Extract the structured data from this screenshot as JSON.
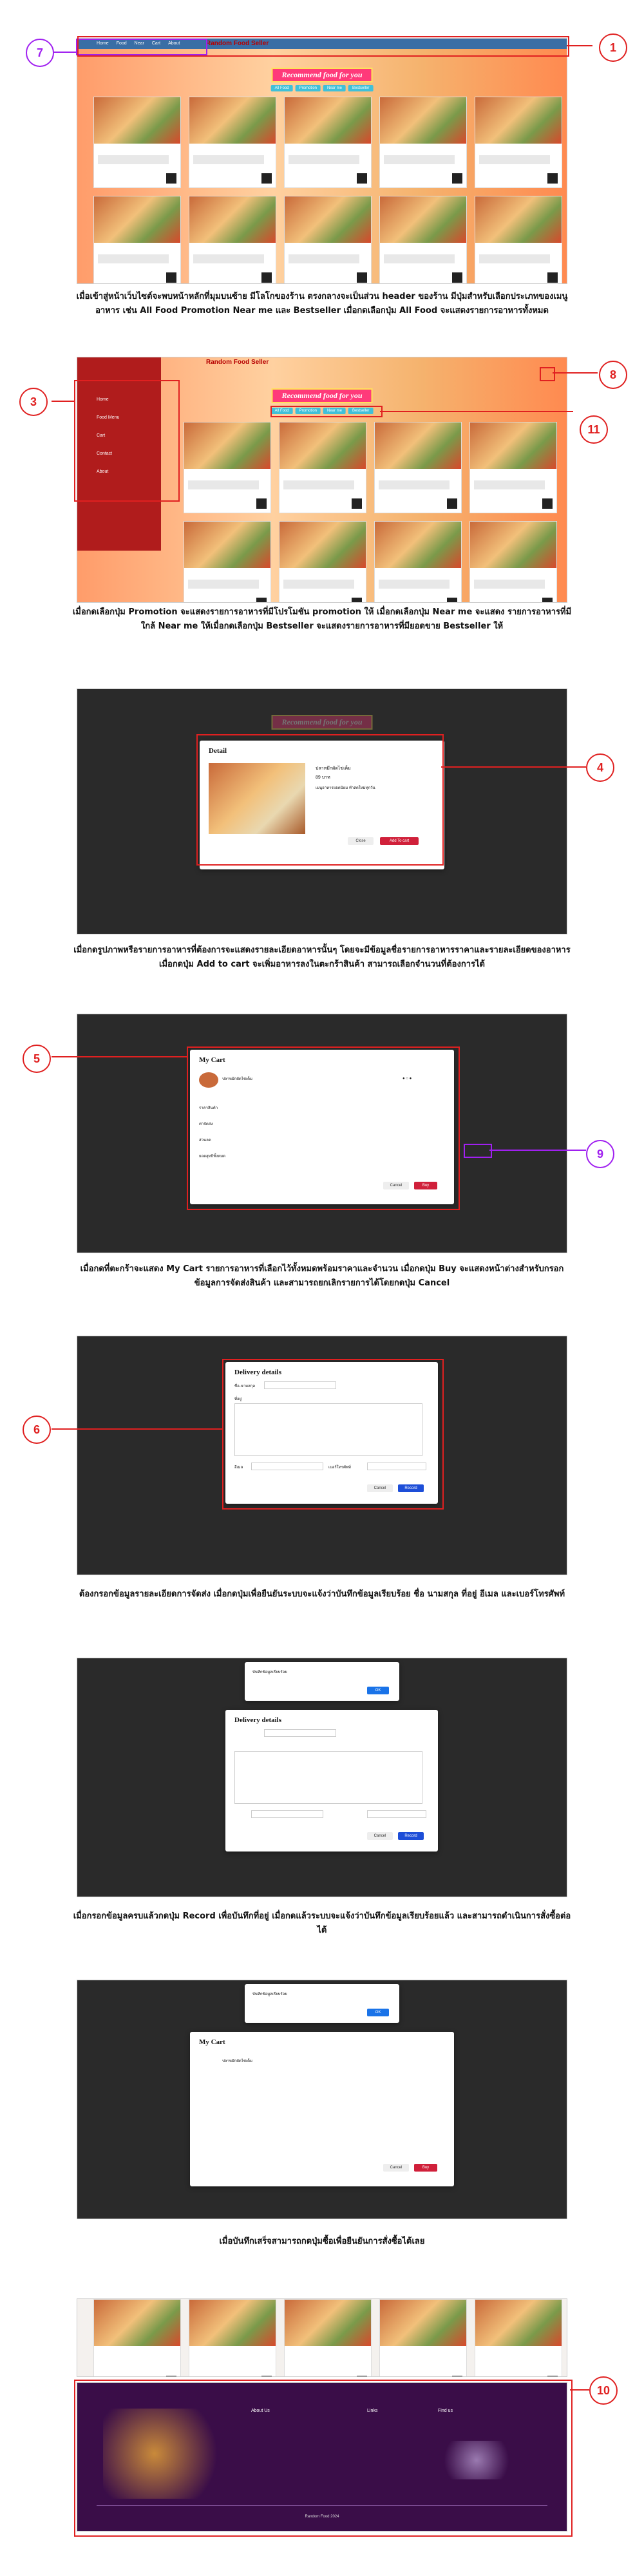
{
  "brand": "Random Food Seller",
  "recommend_banner": "Recommend food for you",
  "nav_links": [
    "Home",
    "Food",
    "Near",
    "Cart",
    "About"
  ],
  "pills": [
    "All Food",
    "Promotion",
    "Near me",
    "Bestseller"
  ],
  "callouts": {
    "c1": "1",
    "c3": "3",
    "c4": "4",
    "c5": "5",
    "c6": "6",
    "c7": "7",
    "c8": "8",
    "c9": "9",
    "c10": "10",
    "c11": "11"
  },
  "captions": {
    "cap1": "เมื่อเข้าสู่หน้าเว็บไซต์จะพบหน้าหลักที่มุมบนซ้าย มีโลโกของร้าน ตรงกลางจะเป็นส่วน header ของร้าน มีปุ่มสำหรับเลือกประเภทของเมนู อาหาร เช่น All Food Promotion Near me และ Bestseller เมื่อกดเลือกปุ่ม All Food จะแสดงรายการอาหารทั้งหมด",
    "cap2": "เมื่อกดเลือกปุ่ม Promotion จะแสดงรายการอาหารที่มีโปรโมชัน promotion ให้ เมื่อกดเลือกปุ่ม Near me จะแสดง รายการอาหารที่มีใกล้ Near me ให้เมื่อกดเลือกปุ่ม Bestseller จะแสดงรายการอาหารที่มียอดขาย Bestseller ให้",
    "cap3": "เมื่อกดรูปภาพหรือรายการอาหารที่ต้องการจะแสดงรายละเอียดอาหารนั้นๆ โดยจะมีข้อมูลชื่อรายการอาหารราคาและรายละเอียดของอาหาร เมื่อกดปุ่ม Add to cart จะเพิ่มอาหารลงในตะกร้าสินค้า สามารถเลือกจำนวนที่ต้องการได้",
    "cap4": "เมื่อกดที่ตะกร้าจะแสดง My Cart รายการอาหารที่เลือกไว้ทั้งหมดพร้อมราคาและจำนวน เมื่อกดปุ่ม Buy จะแสดงหน้าต่างสำหรับกรอกข้อมูลการจัดส่งสินค้า และสามารถยกเลิกรายการได้โดยกดปุ่ม Cancel",
    "cap5": "ต้องกรอกข้อมูลรายละเอียดการจัดส่ง เมื่อกดปุ่มเพื่อยืนยันระบบจะแจ้งว่าบันทึกข้อมูลเรียบร้อย ชื่อ นามสกุล ที่อยู่ อีเมล และเบอร์โทรศัพท์",
    "cap6": "เมื่อกรอกข้อมูลครบแล้วกดปุ่ม Record เพื่อบันทึกที่อยู่ เมื่อกดแล้วระบบจะแจ้งว่าบันทึกข้อมูลเรียบร้อยแล้ว และสามารถดำเนินการสั่งซื้อต่อได้",
    "cap7": "เมื่อบันทึกเสร็จสามารถกดปุ่มซื้อเพื่อยืนยันการสั่งซื้อได้เลย"
  },
  "detail_modal": {
    "title": "Detail",
    "name": "ปลาหมึกผัดไข่เค็ม",
    "price": "89 บาท",
    "desc": "เมนูอาหารยอดนิยม ทำสดใหม่ทุกวัน",
    "close": "Close",
    "add": "Add To cart"
  },
  "cart_modal": {
    "title": "My Cart",
    "item": "ปลาหมึกผัดไข่เค็ม",
    "rows": [
      "ราคาสินค้า",
      "ค่าจัดส่ง",
      "ส่วนลด",
      "ยอดสุทธิทั้งหมด"
    ],
    "cancel": "Cancel",
    "buy": "Buy"
  },
  "delivery_modal": {
    "title": "Delivery details",
    "labels": [
      "ชื่อ-นามสกุล",
      "ที่อยู่",
      "อีเมล",
      "เบอร์โทรศัพท์"
    ],
    "cancel": "Cancel",
    "record": "Record"
  },
  "alert": {
    "text": "บันทึกข้อมูลเรียบร้อย",
    "ok": "OK"
  },
  "sidebar_items": [
    "Home",
    "Food Menu",
    "Cart",
    "Contact",
    "About"
  ],
  "footer": {
    "col1": "About Us",
    "col2": "Links",
    "col3": "Find us",
    "copyright": "Random Food 2024"
  }
}
